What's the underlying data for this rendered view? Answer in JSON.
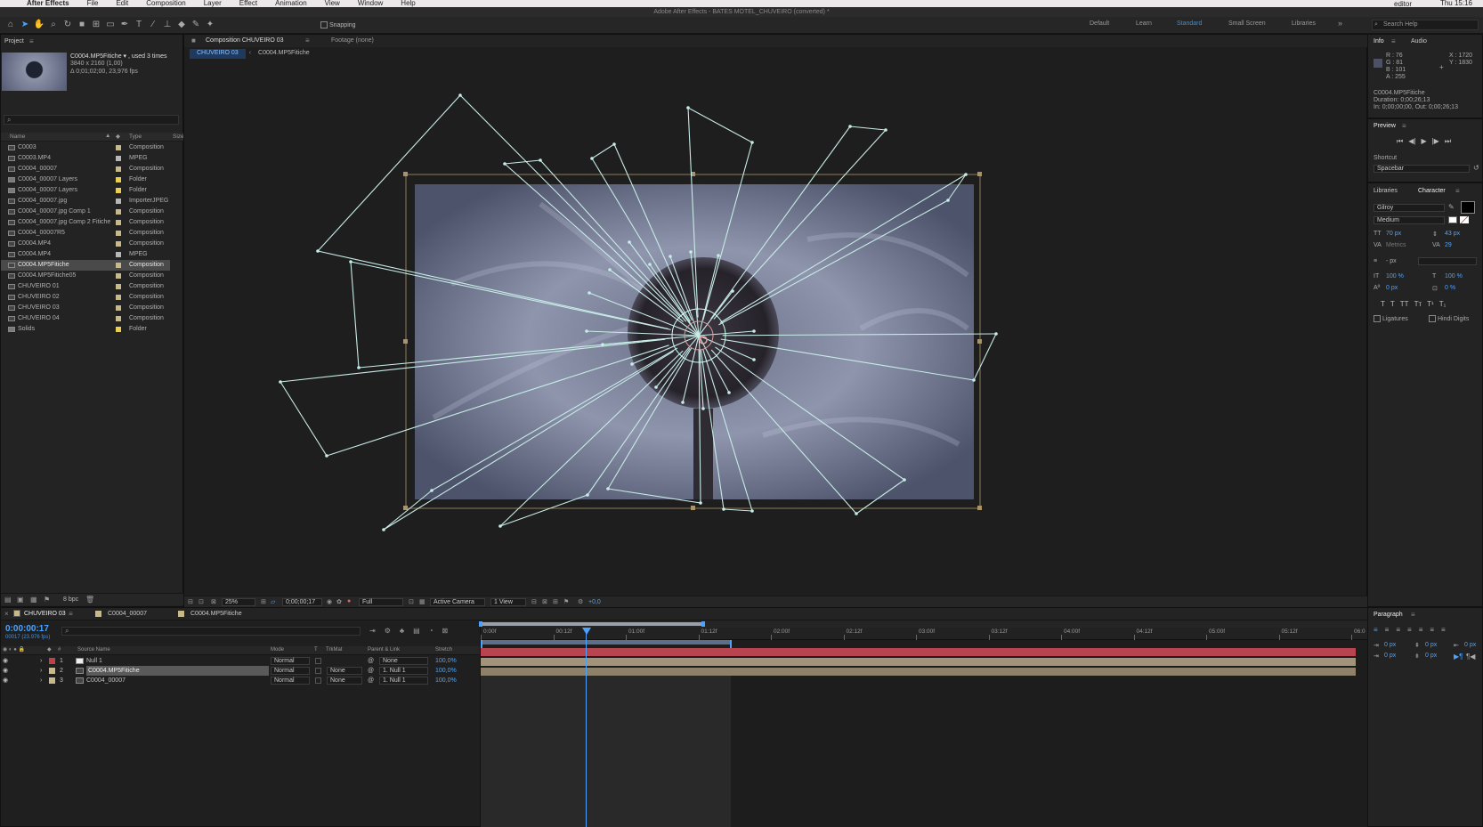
{
  "menubar": {
    "app": "After Effects",
    "items": [
      "File",
      "Edit",
      "Composition",
      "Layer",
      "Effect",
      "Animation",
      "View",
      "Window",
      "Help"
    ],
    "user": "editor",
    "clock": "Thu 15:16"
  },
  "window_title": "Adobe After Effects - BATES MOTEL_CHUVEIRO (converted) *",
  "toolbar": {
    "snapping": "Snapping",
    "workspaces": [
      "Default",
      "Learn",
      "Standard",
      "Small Screen",
      "Libraries"
    ],
    "active_workspace": "Standard",
    "search_placeholder": "Search Help"
  },
  "project": {
    "title": "Project",
    "selected_name": "C0004.MP5Fitiche ▾ , used 3 times",
    "selected_info1": "3840 x 2160 (1,00)",
    "selected_info2": "Δ 0;01;02;00, 23,976 fps",
    "col_name": "Name",
    "col_type": "Type",
    "col_size": "Size",
    "bpc": "8 bpc",
    "items": [
      {
        "name": "C0003",
        "type": "Composition",
        "color": "#c7b98a",
        "kind": "comp"
      },
      {
        "name": "C0003.MP4",
        "type": "MPEG",
        "color": "#b7b7b7",
        "kind": "file"
      },
      {
        "name": "C0004_00007",
        "type": "Composition",
        "color": "#c7b98a",
        "kind": "comp"
      },
      {
        "name": "C0004_00007 Layers",
        "type": "Folder",
        "color": "#e8cf54",
        "kind": "folder"
      },
      {
        "name": "C0004_00007 Layers",
        "type": "Folder",
        "color": "#e8cf54",
        "kind": "folder"
      },
      {
        "name": "C0004_00007.jpg",
        "type": "ImporterJPEG",
        "color": "#b7b7b7",
        "kind": "file"
      },
      {
        "name": "C0004_00007.jpg Comp 1",
        "type": "Composition",
        "color": "#c7b98a",
        "kind": "comp"
      },
      {
        "name": "C0004_00007.jpg Comp 2 Fitiche",
        "type": "Composition",
        "color": "#c7b98a",
        "kind": "comp"
      },
      {
        "name": "C0004_00007R5",
        "type": "Composition",
        "color": "#c7b98a",
        "kind": "comp"
      },
      {
        "name": "C0004.MP4",
        "type": "Composition",
        "color": "#c7b98a",
        "kind": "comp"
      },
      {
        "name": "C0004.MP4",
        "type": "MPEG",
        "color": "#b7b7b7",
        "kind": "file"
      },
      {
        "name": "C0004.MP5Fitiche",
        "type": "Composition",
        "color": "#c7b98a",
        "kind": "comp",
        "selected": true
      },
      {
        "name": "C0004.MP5Fitiche05",
        "type": "Composition",
        "color": "#c7b98a",
        "kind": "comp"
      },
      {
        "name": "CHUVEIRO 01",
        "type": "Composition",
        "color": "#c7b98a",
        "kind": "comp"
      },
      {
        "name": "CHUVEIRO 02",
        "type": "Composition",
        "color": "#c7b98a",
        "kind": "comp"
      },
      {
        "name": "CHUVEIRO 03",
        "type": "Composition",
        "color": "#c7b98a",
        "kind": "comp"
      },
      {
        "name": "CHUVEIRO 04",
        "type": "Composition",
        "color": "#c7b98a",
        "kind": "comp"
      },
      {
        "name": "Solids",
        "type": "Folder",
        "color": "#e8cf54",
        "kind": "folder"
      }
    ]
  },
  "viewer": {
    "comp_tab": "Composition CHUVEIRO 03",
    "footage_tab": "Footage (none)",
    "crumbs": [
      "CHUVEIRO 03",
      "C0004.MP5Fitiche"
    ],
    "zoom": "25%",
    "timecode": "0;00;00;17",
    "resolution": "Full",
    "camera": "Active Camera",
    "views": "1 View",
    "exposure": "+0,0"
  },
  "info": {
    "tabs": [
      "Info",
      "Audio"
    ],
    "r": "R : 76",
    "g": "G : 81",
    "b": "B : 101",
    "a": "A : 255",
    "x": "X : 1720",
    "y": "Y : 1830",
    "line1": "C0004.MP5Fitiche",
    "line2": "Duration: 0;00;26;13",
    "line3": "In: 0;00;00;00, Out: 0;00;26;13"
  },
  "preview": {
    "title": "Preview",
    "shortcut_label": "Shortcut",
    "shortcut": "Spacebar"
  },
  "character": {
    "tabs": [
      "Libraries",
      "Character"
    ],
    "font": "Gilroy",
    "style": "Medium",
    "size": "70 px",
    "leading": "43 px",
    "kerning": "Metrics",
    "tracking": "29",
    "stroke": "- px",
    "vscale": "100 %",
    "hscale": "100 %",
    "baseline": "0 px",
    "tsume": "0 %",
    "ligatures": "Ligatures",
    "hindi": "Hindi Digits"
  },
  "paragraph": {
    "title": "Paragraph",
    "v1": "0 px",
    "v2": "0 px",
    "v3": "0 px",
    "v4": "0 px",
    "v5": "0 px"
  },
  "timeline": {
    "tabs": [
      "CHUVEIRO 03",
      "C0004_00007",
      "C0004.MP5Fitiche"
    ],
    "timecode": "0:00:00:17",
    "fps": "00017 (23.976 fps)",
    "cols": {
      "source": "Source Name",
      "mode": "Mode",
      "t": "T",
      "trkmat": "TrkMat",
      "parent": "Parent & Link",
      "stretch": "Stretch"
    },
    "layers": [
      {
        "num": "1",
        "name": "Null 1",
        "mode": "Normal",
        "trkmat": "",
        "parent": "None",
        "stretch": "100,0%",
        "color": "#c0404a"
      },
      {
        "num": "2",
        "name": "C0004.MP5Fitiche",
        "mode": "Normal",
        "trkmat": "None",
        "parent": "1. Null 1",
        "stretch": "100,0%",
        "color": "#c7b98a",
        "selected": true
      },
      {
        "num": "3",
        "name": "C0004_00007",
        "mode": "Normal",
        "trkmat": "None",
        "parent": "1. Null 1",
        "stretch": "100,0%",
        "color": "#c7b98a"
      }
    ],
    "ruler": [
      "0:00f",
      "00:12f",
      "01:00f",
      "01:12f",
      "02:00f",
      "02:12f",
      "03:00f",
      "03:12f",
      "04:00f",
      "04:12f",
      "05:00f",
      "05:12f",
      "06:0"
    ]
  }
}
